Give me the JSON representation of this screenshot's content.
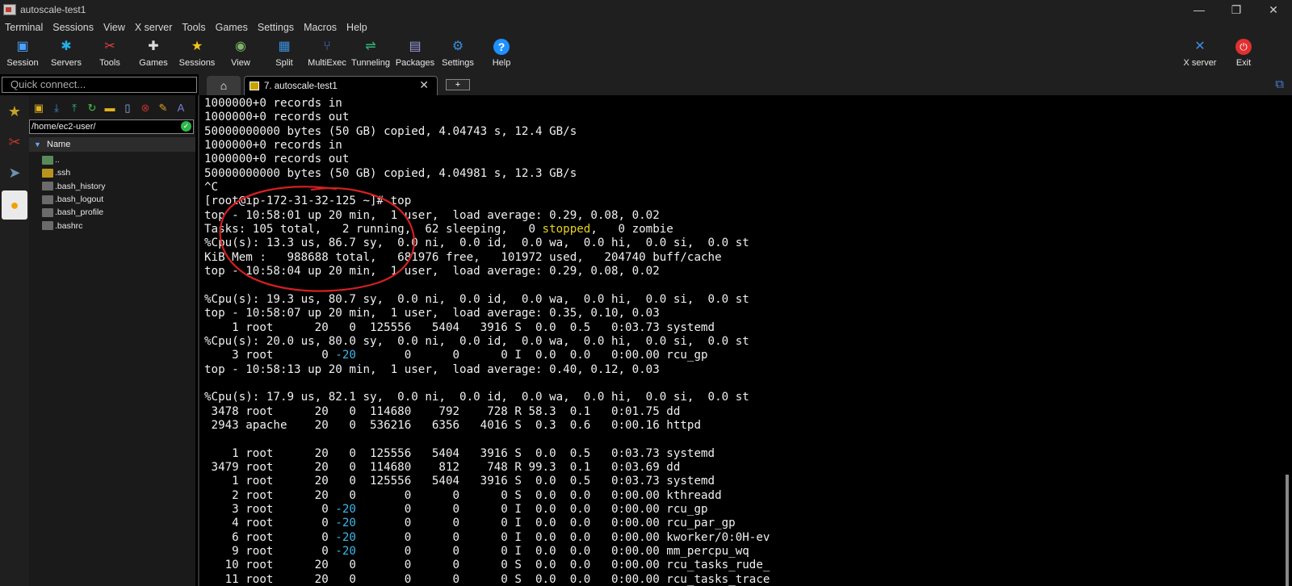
{
  "window": {
    "title": "autoscale-test1",
    "minimize": "—",
    "restore": "❐",
    "close": "✕"
  },
  "menu": [
    "Terminal",
    "Sessions",
    "View",
    "X server",
    "Tools",
    "Games",
    "Settings",
    "Macros",
    "Help"
  ],
  "toolbar": {
    "left": [
      {
        "label": "Session",
        "icon": "session-icon",
        "color": "#4aa3ff"
      },
      {
        "label": "Servers",
        "icon": "servers-icon",
        "color": "#23b0e8"
      },
      {
        "label": "Tools",
        "icon": "tools-icon",
        "color": "#e84040"
      },
      {
        "label": "Games",
        "icon": "games-icon",
        "color": "#dddddd"
      },
      {
        "label": "Sessions",
        "icon": "star-icon",
        "color": "#f5c518"
      },
      {
        "label": "View",
        "icon": "view-icon",
        "color": "#7db36b"
      },
      {
        "label": "Split",
        "icon": "split-icon",
        "color": "#3a8fe0"
      },
      {
        "label": "MultiExec",
        "icon": "multiexec-icon",
        "color": "#5b6fd8"
      },
      {
        "label": "Tunneling",
        "icon": "tunneling-icon",
        "color": "#2fb37a"
      },
      {
        "label": "Packages",
        "icon": "packages-icon",
        "color": "#9a9adf"
      },
      {
        "label": "Settings",
        "icon": "gear-icon",
        "color": "#3a8fe0"
      },
      {
        "label": "Help",
        "icon": "help-icon",
        "color": "#1e90ff"
      }
    ],
    "right": [
      {
        "label": "X server",
        "icon": "xserver-icon",
        "color": "#3a8fe0"
      },
      {
        "label": "Exit",
        "icon": "power-icon",
        "color": "#e03030"
      }
    ]
  },
  "quick_connect": {
    "placeholder": "Quick connect..."
  },
  "tabs": {
    "session_label": "7. autoscale-test1",
    "add_label": "+"
  },
  "sftp": {
    "path": "/home/ec2-user/",
    "column": "Name",
    "files": [
      {
        "name": "..",
        "type": "up"
      },
      {
        "name": ".ssh",
        "type": "folder"
      },
      {
        "name": ".bash_history",
        "type": "file"
      },
      {
        "name": ".bash_logout",
        "type": "file"
      },
      {
        "name": ".bash_profile",
        "type": "file"
      },
      {
        "name": ".bashrc",
        "type": "file"
      }
    ]
  },
  "terminal": {
    "lines": [
      "1000000+0 records in",
      "1000000+0 records out",
      "50000000000 bytes (50 GB) copied, 4.04743 s, 12.4 GB/s",
      "1000000+0 records in",
      "1000000+0 records out",
      "50000000000 bytes (50 GB) copied, 4.04981 s, 12.3 GB/s",
      "^C",
      "[root@ip-172-31-32-125 ~]# top",
      "top - 10:58:01 up 20 min,  1 user,  load average: 0.29, 0.08, 0.02",
      [
        "Tasks: 105 total,   2 running,  62 sleeping,   0 ",
        {
          "t": "stopped",
          "c": "y"
        },
        ",   0 zombie"
      ],
      "%Cpu(s): 13.3 us, 86.7 sy,  0.0 ni,  0.0 id,  0.0 wa,  0.0 hi,  0.0 si,  0.0 st",
      "KiB Mem :   988688 total,   681976 free,   101972 used,   204740 buff/cache",
      "top - 10:58:04 up 20 min,  1 user,  load average: 0.29, 0.08, 0.02",
      "",
      "%Cpu(s): 19.3 us, 80.7 sy,  0.0 ni,  0.0 id,  0.0 wa,  0.0 hi,  0.0 si,  0.0 st",
      "top - 10:58:07 up 20 min,  1 user,  load average: 0.35, 0.10, 0.03",
      "    1 root      20   0  125556   5404   3916 S  0.0  0.5   0:03.73 systemd",
      "%Cpu(s): 20.0 us, 80.0 sy,  0.0 ni,  0.0 id,  0.0 wa,  0.0 hi,  0.0 si,  0.0 st",
      [
        "    3 root       0 ",
        {
          "t": "-20",
          "c": "c"
        },
        "       0      0      0 I  0.0  0.0   0:00.00 rcu_gp"
      ],
      "top - 10:58:13 up 20 min,  1 user,  load average: 0.40, 0.12, 0.03",
      "",
      "%Cpu(s): 17.9 us, 82.1 sy,  0.0 ni,  0.0 id,  0.0 wa,  0.0 hi,  0.0 si,  0.0 st",
      " 3478 root      20   0  114680    792    728 R 58.3  0.1   0:01.75 dd",
      " 2943 apache    20   0  536216   6356   4016 S  0.3  0.6   0:00.16 httpd",
      "",
      "    1 root      20   0  125556   5404   3916 S  0.0  0.5   0:03.73 systemd",
      " 3479 root      20   0  114680    812    748 R 99.3  0.1   0:03.69 dd",
      "    1 root      20   0  125556   5404   3916 S  0.0  0.5   0:03.73 systemd",
      "    2 root      20   0       0      0      0 S  0.0  0.0   0:00.00 kthreadd",
      [
        "    3 root       0 ",
        {
          "t": "-20",
          "c": "c"
        },
        "       0      0      0 I  0.0  0.0   0:00.00 rcu_gp"
      ],
      [
        "    4 root       0 ",
        {
          "t": "-20",
          "c": "c"
        },
        "       0      0      0 I  0.0  0.0   0:00.00 rcu_par_gp"
      ],
      [
        "    6 root       0 ",
        {
          "t": "-20",
          "c": "c"
        },
        "       0      0      0 I  0.0  0.0   0:00.00 kworker/0:0H-ev"
      ],
      [
        "    9 root       0 ",
        {
          "t": "-20",
          "c": "c"
        },
        "       0      0      0 I  0.0  0.0   0:00.00 mm_percpu_wq"
      ],
      "   10 root      20   0       0      0      0 S  0.0  0.0   0:00.00 rcu_tasks_rude_",
      "   11 root      20   0       0      0      0 S  0.0  0.0   0:00.00 rcu_tasks_trace"
    ]
  }
}
